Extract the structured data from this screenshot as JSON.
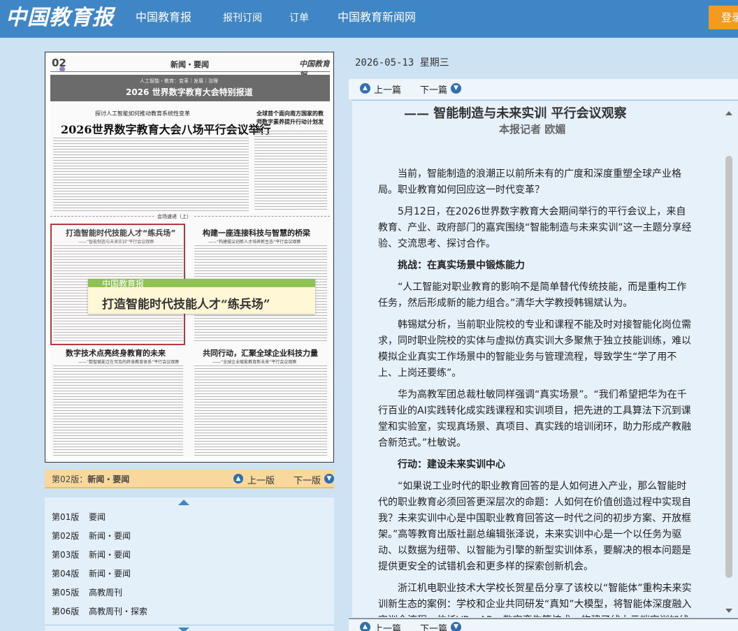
{
  "header": {
    "logo": "中国教育报",
    "nav": [
      "中国教育报",
      "报刊订阅",
      "订单",
      "中国教育新闻网"
    ],
    "login_label": "登录"
  },
  "paper_preview": {
    "page_no": "02",
    "section": "新闻・要闻",
    "brand": "中国教育报",
    "banner_sub": "人工智能・教育：变革｜发展｜治理",
    "banner_main": "2026 世界数字教育大会特别报道",
    "kicker": "探讨人工智能如何推动教育系统性变革",
    "lead_headline": "2026世界数字教育大会八场平行会议举行",
    "side_headline": "全球首个面向南方国家的教师数字素养提升行动计划发布",
    "divider_label": "会场速递（上）",
    "headlines": [
      {
        "title": "打造智能时代技能人才“练兵场”",
        "sub": "——“智能制造与未来实训”平行会议观察"
      },
      {
        "title": "构建一座连接科技与智慧的桥梁",
        "sub": "——“构建拔尖创新人才培养新生态”平行会议观察"
      },
      {
        "title": "数字技术点亮终身教育的未来",
        "sub": "——“数智赋能泛在可及的终身教育体系”平行会议观察"
      },
      {
        "title": "共同行动，汇聚全球企业科技力量",
        "sub": "——“全球企业赋能教育新未来”平行会议观察"
      }
    ],
    "tooltip_source": "中国教育报",
    "tooltip_title": "打造智能时代技能人才“练兵场”"
  },
  "pagebar": {
    "current_prefix": "第02版：",
    "current_name": "新闻・要闻",
    "prev_label": "上一版",
    "next_label": "下一版"
  },
  "page_list": [
    {
      "no": "第01版",
      "name": "要闻"
    },
    {
      "no": "第02版",
      "name": "新闻・要闻"
    },
    {
      "no": "第03版",
      "name": "新闻・要闻"
    },
    {
      "no": "第04版",
      "name": "新闻・要闻"
    },
    {
      "no": "第05版",
      "name": "高教周刊"
    },
    {
      "no": "第06版",
      "name": "高教周刊・探索"
    }
  ],
  "article": {
    "date": "2026-05-13 星期三",
    "prev_label": "上一篇",
    "next_label": "下一篇",
    "title": "——  智能制造与未来实训  平行会议观察",
    "author": "本报记者  欧媚",
    "paragraphs": [
      {
        "type": "p",
        "text": "当前，智能制造的浪潮正以前所未有的广度和深度重塑全球产业格局。职业教育如何回应这一时代变革？"
      },
      {
        "type": "p",
        "text": "5月12日，在2026世界数字教育大会期间举行的平行会议上，来自教育、产业、政府部门的嘉宾围绕“智能制造与未来实训”这一主题分享经验、交流思考、探讨合作。"
      },
      {
        "type": "sub",
        "text": "挑战：在真实场景中锻炼能力"
      },
      {
        "type": "p",
        "text": "“人工智能对职业教育的影响不是简单替代传统技能，而是重构工作任务，然后形成新的能力组合。”清华大学教授韩锡斌认为。"
      },
      {
        "type": "p",
        "text": "韩锡斌分析，当前职业院校的专业和课程不能及时对接智能化岗位需求，同时职业院校的实体与虚拟仿真实训大多聚焦于独立技能训练，难以模拟企业真实工作场景中的智能业务与管理流程，导致学生“学了用不上、上岗还要练”。"
      },
      {
        "type": "p",
        "text": "华为高教军团总裁杜敏同样强调“真实场景”。“我们希望把华为在千行百业的AI实践转化成实践课程和实训项目，把先进的工具算法下沉到课堂和实验室，实现真场景、真项目、真实践的培训闭环，助力形成产教融合新范式。”杜敏说。"
      },
      {
        "type": "sub",
        "text": "行动：建设未来实训中心"
      },
      {
        "type": "p",
        "text": "“如果说工业时代的职业教育回答的是人如何进入产业，那么智能时代的职业教育必须回答更深层次的命题：人如何在价值创造过程中实现自我？未来实训中心是中国职业教育回答这一时代之问的初步方案、开放框架。”高等教育出版社副总编辑张泽说，未来实训中心是一个以任务为驱动、以数据为纽带、以智能为引擎的新型实训体系，要解决的根本问题是提供更安全的试错机会和更多样的探索创新机会。"
      },
      {
        "type": "p",
        "text": "浙江机电职业技术大学校长贺星岳分享了该校以“智能体”重构未来实训新生态的案例：学校和企业共同研发“真知”大模型，将智能体深度融入实训全流程。依托VR、AR、数字孪生等技术，构建了线上云端实训加线下实景操作的双轨体系，深度重塑了教、学、练、评全链条。"
      }
    ]
  }
}
